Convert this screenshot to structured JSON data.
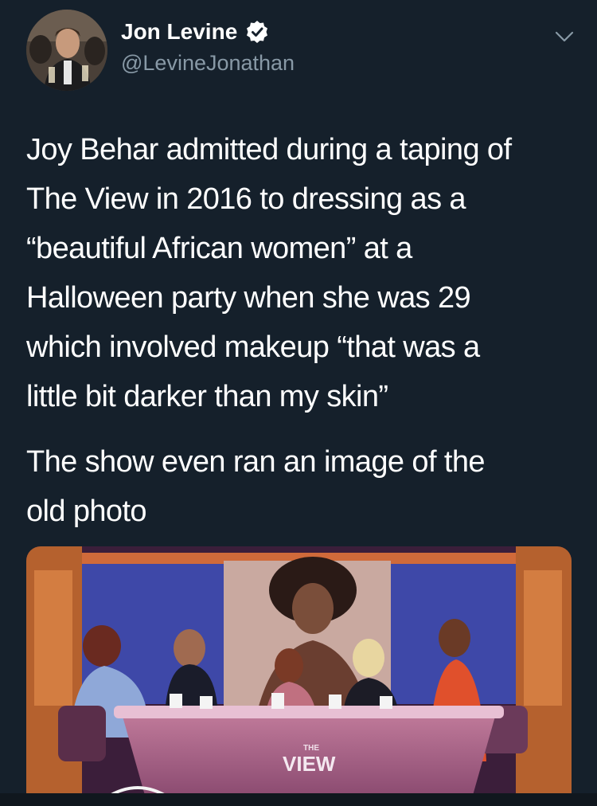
{
  "author": {
    "name": "Jon Levine",
    "handle": "@LevineJonathan",
    "verified_icon": "verified-badge-icon"
  },
  "menu_icon": "chevron-down-icon",
  "body": {
    "paragraph1_lines": [
      "Joy Behar admitted during a taping of",
      "The View in 2016 to dressing as a",
      "“beautiful African women” at a",
      "Halloween party when she was 29",
      "which involved makeup “that was a",
      "little bit darker than my skin”"
    ],
    "paragraph2_lines": [
      "The show even ran an image of the",
      "old photo"
    ]
  },
  "media": {
    "logo_small": "THE",
    "logo_large": "VIEW"
  },
  "colors": {
    "background": "#15202b",
    "secondary_text": "#8899a6",
    "verified_blue": "#1da1f2"
  }
}
